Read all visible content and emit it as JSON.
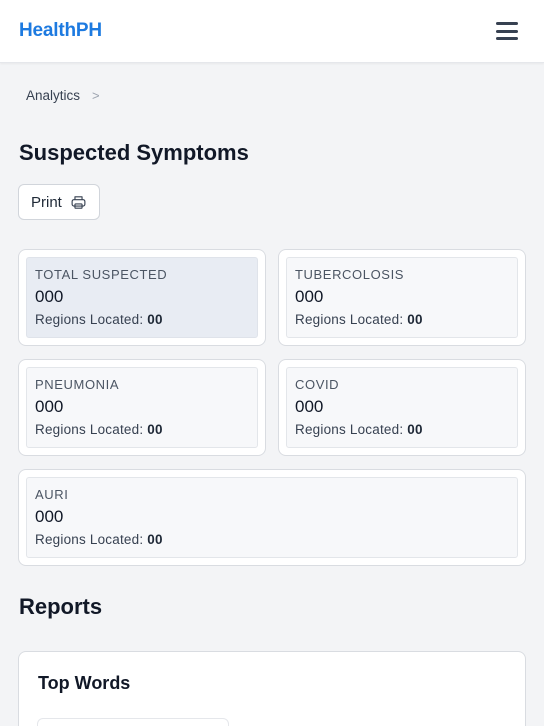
{
  "header": {
    "brand": "HealthPH",
    "menu_icon": "hamburger-menu-icon"
  },
  "breadcrumb": {
    "items": [
      "Analytics"
    ],
    "separator": ">"
  },
  "page": {
    "title": "Suspected Symptoms",
    "print_label": "Print",
    "print_icon": "printer-icon"
  },
  "cards": [
    {
      "title": "TOTAL SUSPECTED",
      "value": "000",
      "sub_label": "Regions Located:",
      "sub_value": "00",
      "active": true
    },
    {
      "title": "TUBERCOLOSIS",
      "value": "000",
      "sub_label": "Regions Located:",
      "sub_value": "00"
    },
    {
      "title": "PNEUMONIA",
      "value": "000",
      "sub_label": "Regions Located:",
      "sub_value": "00"
    },
    {
      "title": "COVID",
      "value": "000",
      "sub_label": "Regions Located:",
      "sub_value": "00"
    },
    {
      "title": "AURI",
      "value": "000",
      "sub_label": "Regions Located:",
      "sub_value": "00"
    }
  ],
  "reports": {
    "section_title": "Reports",
    "top_words_title": "Top Words"
  },
  "colors": {
    "brand": "#1d7ae0",
    "background": "#f3f4f6",
    "active_card": "#e8ecf3"
  }
}
